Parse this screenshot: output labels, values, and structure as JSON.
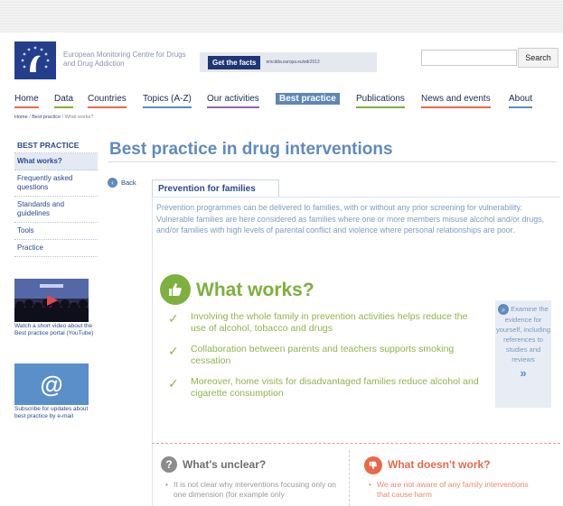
{
  "header": {
    "org_name": "European Monitoring Centre for Drugs and Drug Addiction",
    "facts_button": "Get the facts",
    "facts_url": "emcdda.europa.eu/edr2013",
    "search_placeholder": "",
    "search_button": "Search"
  },
  "nav": {
    "items": [
      {
        "label": "Home",
        "color": "#e8694a"
      },
      {
        "label": "Data",
        "color": "#7db03e"
      },
      {
        "label": "Countries",
        "color": "#e8694a"
      },
      {
        "label": "Topics (A-Z)",
        "color": "#5e8bbf"
      },
      {
        "label": "Our activities",
        "color": "#9a62a8"
      },
      {
        "label": "Best practice",
        "color": "#5f86b8"
      },
      {
        "label": "Publications",
        "color": "#7db03e"
      },
      {
        "label": "News and events",
        "color": "#e8694a"
      },
      {
        "label": "About",
        "color": "#5e8bbf"
      }
    ],
    "active": "Best practice"
  },
  "breadcrumb": {
    "home": "Home",
    "section": "Best practice",
    "current": "What works?",
    "separator": "/"
  },
  "sidebar": {
    "heading": "BEST PRACTICE",
    "items": [
      "What works?",
      "Frequently asked questions",
      "Standards and guidelines",
      "Tools",
      "Practice"
    ],
    "selected": "What works?",
    "video_caption": "Watch a short video about the Best practice portal (YouTube)",
    "subscribe_caption": "Subscribe for updates about best practice by e-mail",
    "subscribe_symbol": "@"
  },
  "main": {
    "title": "Best practice in drug interventions",
    "back": "Back",
    "tab": "Prevention for families",
    "intro": "Prevention programmes can be delivered to families, with or without any prior screening for vulnerability. Vulnerable families are here considered as families where one or more members misuse alcohol and/or drugs, and/or families with high levels of parental conflict and violence where personal relationships are poor.",
    "what_works": {
      "title": "What works?",
      "items": [
        "Involving the whole family in prevention activities helps reduce the use of alcohol, tobacco and drugs",
        "Collaboration between parents and teachers supports smoking cessation",
        "Moreover, home visits for disadvantaged families reduce alcohol and cigarette consumption"
      ]
    },
    "examine": "Examine the evidence for yourself, including references to studies and reviews",
    "examine_arrow": "»",
    "unclear": {
      "title": "What's unclear?",
      "text": "It is not clear why interventions focusing only on one dimension (for example only"
    },
    "doesnt_work": {
      "title": "What doesn't work?",
      "text": "We are not aware of any family interventions that cause harm"
    }
  },
  "colors": {
    "brand_blue": "#5e8bbf",
    "works_green": "#7db03e",
    "dont_orange": "#e8694a"
  },
  "icons": [
    "emcdda-logo-icon",
    "back-arrow-icon",
    "thumbs-up-icon",
    "magnifier-icon",
    "question-icon",
    "thumbs-down-icon",
    "check-icon"
  ]
}
